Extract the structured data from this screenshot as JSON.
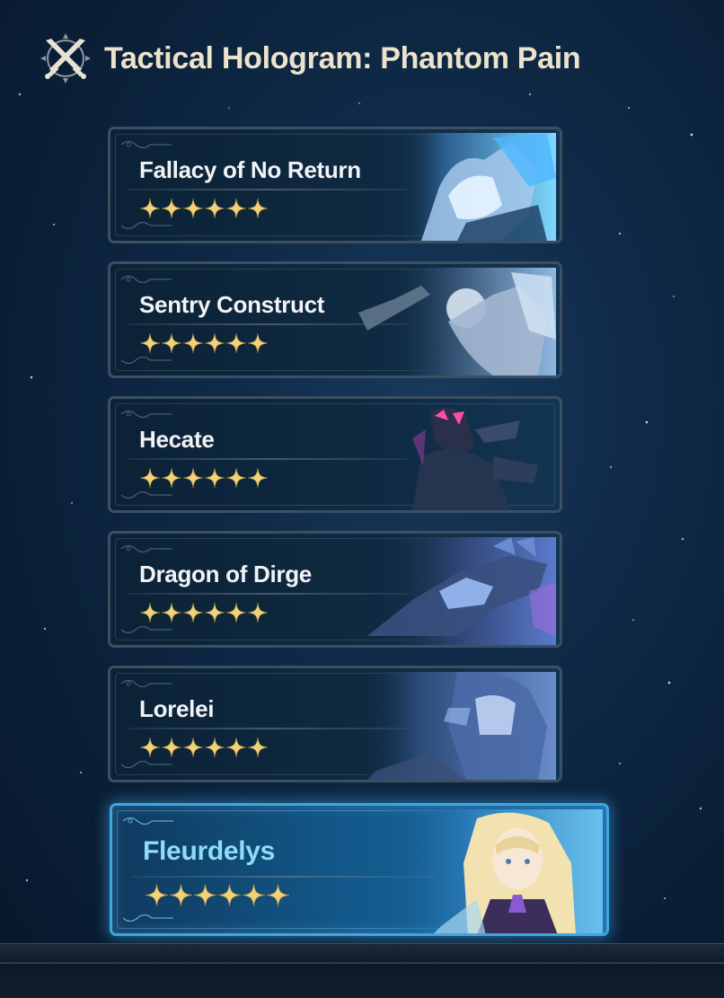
{
  "header": {
    "title": "Tactical Hologram: Phantom Pain",
    "icon": "crossed-swords-icon"
  },
  "bosses": [
    {
      "name": "Fallacy of No Return",
      "stars": 6,
      "selected": false,
      "art_palette": "ice-blue"
    },
    {
      "name": "Sentry Construct",
      "stars": 6,
      "selected": false,
      "art_palette": "silver"
    },
    {
      "name": "Hecate",
      "stars": 6,
      "selected": false,
      "art_palette": "magenta-dark"
    },
    {
      "name": "Dragon of Dirge",
      "stars": 6,
      "selected": false,
      "art_palette": "blue-purple"
    },
    {
      "name": "Lorelei",
      "stars": 6,
      "selected": false,
      "art_palette": "pale-blue"
    },
    {
      "name": "Fleurdelys",
      "stars": 6,
      "selected": true,
      "art_palette": "golden"
    }
  ],
  "colors": {
    "title": "#ece3cc",
    "star": "#f0d27a",
    "selected_border": "#3fa6e0",
    "selected_name": "#8fdcf6"
  }
}
